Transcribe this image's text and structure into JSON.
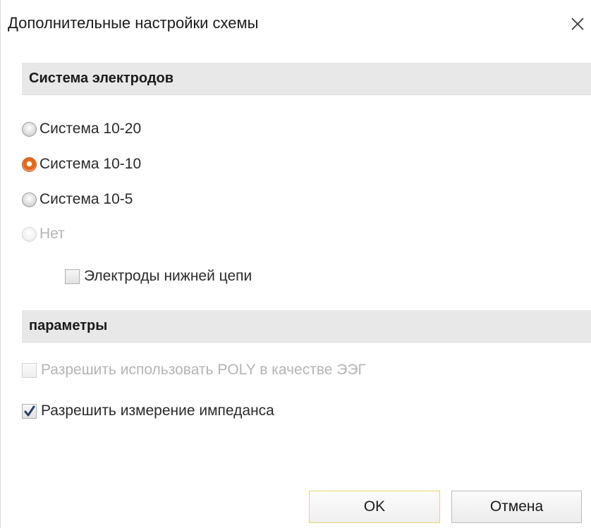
{
  "dialog": {
    "title": "Дополнительные настройки схемы",
    "close_icon": "close-icon"
  },
  "sections": {
    "electrodes": {
      "header": "Система электродов",
      "options": [
        {
          "label": "Система 10-20",
          "checked": false,
          "disabled": false
        },
        {
          "label": "Система 10-10",
          "checked": true,
          "disabled": false
        },
        {
          "label": "Система 10-5",
          "checked": false,
          "disabled": false
        },
        {
          "label": "Нет",
          "checked": false,
          "disabled": true
        }
      ],
      "lower_chain": {
        "label": "Электроды нижней цепи",
        "checked": false
      }
    },
    "params": {
      "header": "параметры",
      "allow_poly": {
        "label": "Разрешить использовать POLY в качестве ЭЭГ",
        "checked": false,
        "disabled": true
      },
      "allow_impedance": {
        "label": "Разрешить измерение импеданса",
        "checked": true,
        "disabled": false
      }
    }
  },
  "buttons": {
    "ok": "OK",
    "cancel": "Отмена"
  },
  "colors": {
    "section_bg": "#e8e8e8",
    "radio_checked": "#e8761f",
    "default_button_border": "#f0d36b",
    "disabled_text": "#b5b5b5"
  }
}
